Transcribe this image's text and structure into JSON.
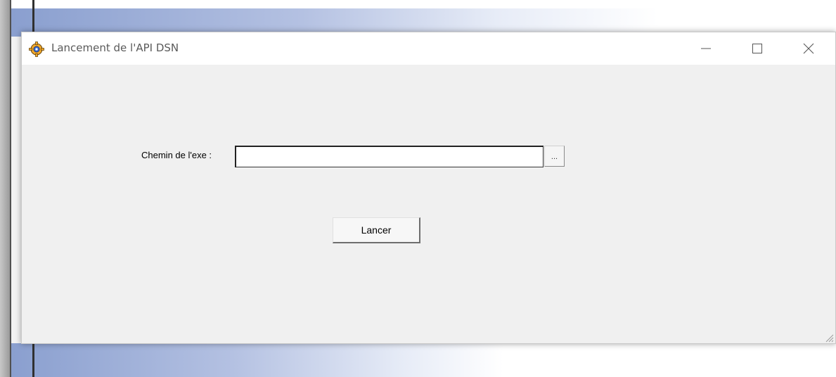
{
  "window": {
    "title": "Lancement de l'API DSN",
    "icon": "app-gear-icon",
    "controls": {
      "minimize": "minimize-icon",
      "maximize": "maximize-icon",
      "close": "close-icon"
    }
  },
  "form": {
    "path_label": "Chemin de l'exe :",
    "path_value": "",
    "browse_label": "...",
    "launch_label": "Lancer"
  },
  "colors": {
    "dialog_bg": "#f0f0f0",
    "titlebar_bg": "#ffffff",
    "title_text": "#5a5a5a",
    "background_band": "#8a9fcf"
  }
}
